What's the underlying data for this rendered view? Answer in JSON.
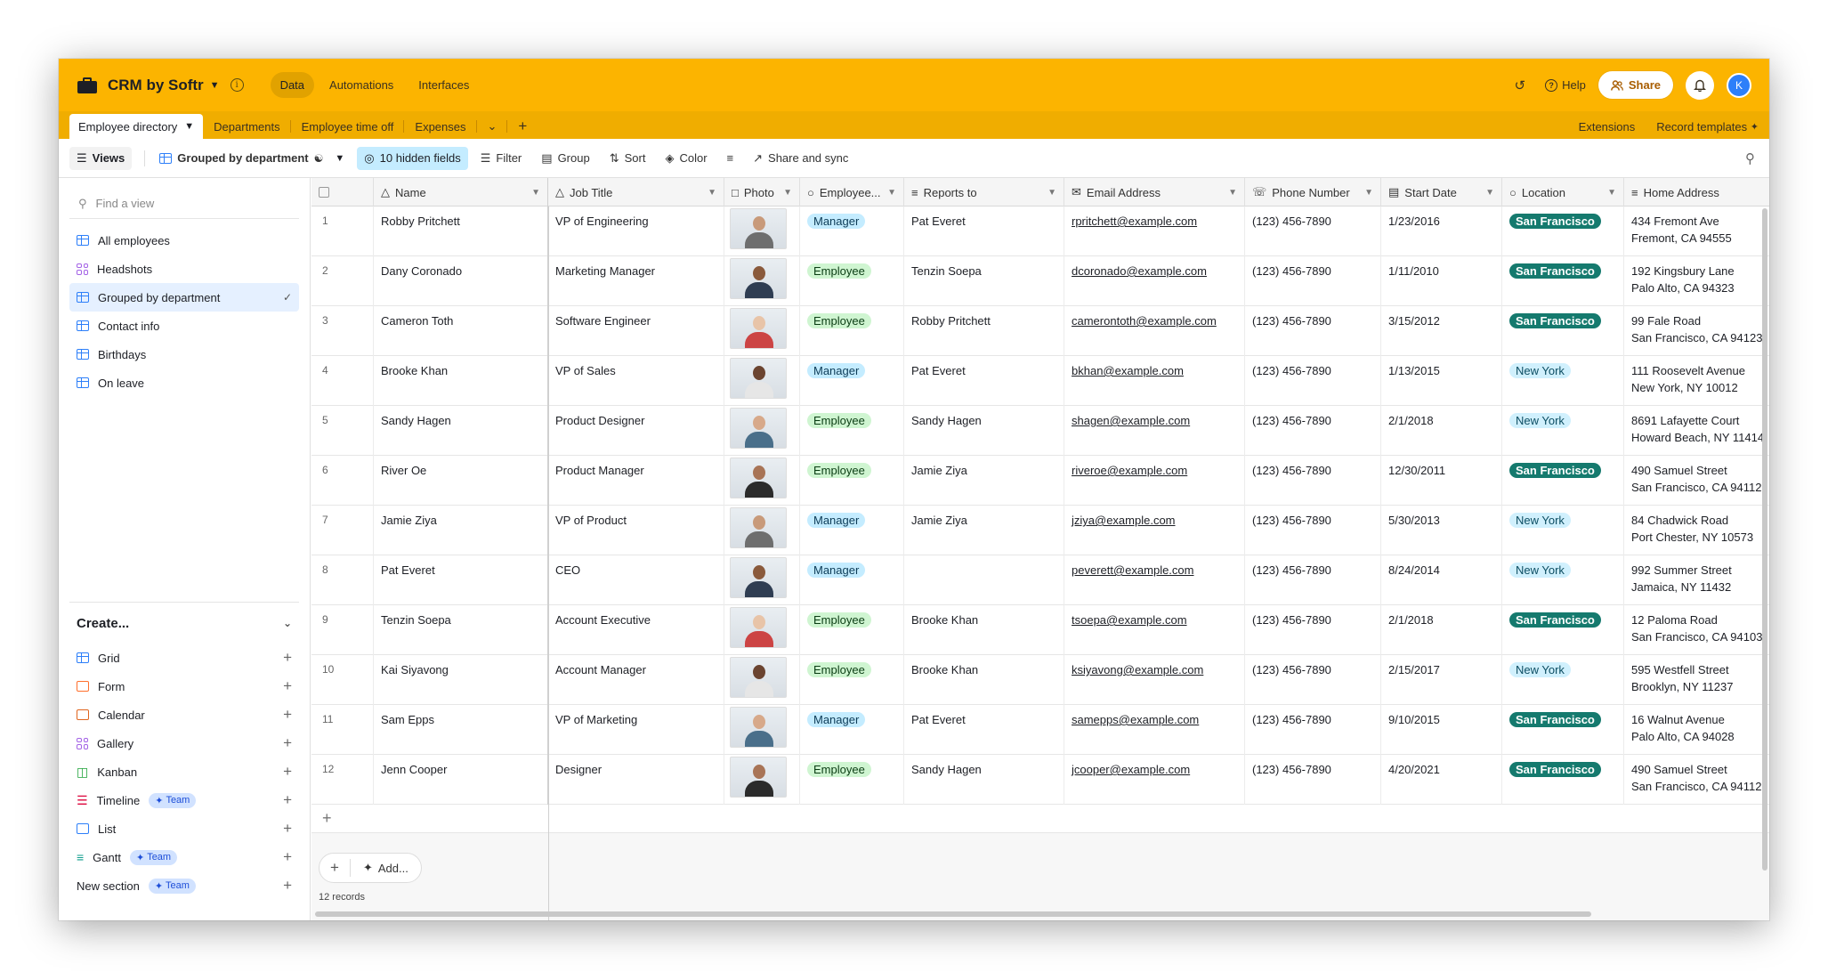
{
  "app": {
    "base_name": "CRM by Softr",
    "nav_tabs": [
      "Data",
      "Automations",
      "Interfaces"
    ],
    "help_label": "Help",
    "share_label": "Share",
    "avatar_initial": "K",
    "accent_color": "#fcb400"
  },
  "tables": {
    "items": [
      "Employee directory",
      "Departments",
      "Employee time off",
      "Expenses"
    ],
    "extensions_label": "Extensions",
    "record_templates_label": "Record templates"
  },
  "toolbar": {
    "views_label": "Views",
    "current_view": "Grouped by department",
    "hidden_fields": "10 hidden fields",
    "filter": "Filter",
    "group": "Group",
    "sort": "Sort",
    "color": "Color",
    "share_sync": "Share and sync"
  },
  "sidebar": {
    "find_placeholder": "Find a view",
    "views": [
      {
        "label": "All employees",
        "icon": "grid-icon"
      },
      {
        "label": "Headshots",
        "icon": "gallery-icon"
      },
      {
        "label": "Grouped by department",
        "icon": "grid-icon"
      },
      {
        "label": "Contact info",
        "icon": "grid-icon"
      },
      {
        "label": "Birthdays",
        "icon": "grid-icon"
      },
      {
        "label": "On leave",
        "icon": "grid-icon"
      }
    ],
    "create_label": "Create...",
    "create_items": [
      {
        "label": "Grid"
      },
      {
        "label": "Form"
      },
      {
        "label": "Calendar"
      },
      {
        "label": "Gallery"
      },
      {
        "label": "Kanban"
      },
      {
        "label": "Timeline",
        "badge": "Team"
      },
      {
        "label": "List"
      },
      {
        "label": "Gantt",
        "badge": "Team"
      },
      {
        "label": "New section",
        "badge": "Team"
      }
    ]
  },
  "grid": {
    "columns": [
      "Name",
      "Job Title",
      "Photo",
      "Employee...",
      "Reports to",
      "Email Address",
      "Phone Number",
      "Start Date",
      "Location",
      "Home Address"
    ],
    "rows": [
      {
        "n": "1",
        "name": "Robby Pritchett",
        "job": "VP of Engineering",
        "type": "Manager",
        "reports": "Pat Everet",
        "email": "rpritchett@example.com",
        "phone": "(123) 456-7890",
        "start": "1/23/2016",
        "loc": "San Francisco",
        "addr1": "434 Fremont Ave",
        "addr2": "Fremont, CA 94555",
        "edge": "6"
      },
      {
        "n": "2",
        "name": "Dany Coronado",
        "job": "Marketing Manager",
        "type": "Employee",
        "reports": "Tenzin Soepa",
        "email": "dcoronado@example.com",
        "phone": "(123) 456-7890",
        "start": "1/11/2010",
        "loc": "San Francisco",
        "addr1": "192 Kingsbury Lane",
        "addr2": "Palo Alto, CA 94323",
        "edge": "1"
      },
      {
        "n": "3",
        "name": "Cameron Toth",
        "job": "Software Engineer",
        "type": "Employee",
        "reports": "Robby Pritchett",
        "email": "camerontoth@example.com",
        "phone": "(123) 456-7890",
        "start": "3/15/2012",
        "loc": "San Francisco",
        "addr1": "99 Fale Road",
        "addr2": "San Francisco, CA 94123",
        "edge": "1"
      },
      {
        "n": "4",
        "name": "Brooke Khan",
        "job": "VP of Sales",
        "type": "Manager",
        "reports": "Pat Everet",
        "email": "bkhan@example.com",
        "phone": "(123) 456-7890",
        "start": "1/13/2015",
        "loc": "New York",
        "addr1": "111 Roosevelt Avenue",
        "addr2": "New York, NY 10012",
        "edge": "7"
      },
      {
        "n": "5",
        "name": "Sandy Hagen",
        "job": "Product Designer",
        "type": "Employee",
        "reports": "Sandy Hagen",
        "email": "shagen@example.com",
        "phone": "(123) 456-7890",
        "start": "2/1/2018",
        "loc": "New York",
        "addr1": "8691 Lafayette Court",
        "addr2": "Howard Beach, NY 11414",
        "edge": "4"
      },
      {
        "n": "6",
        "name": "River Oe",
        "job": "Product Manager",
        "type": "Employee",
        "reports": "Jamie Ziya",
        "email": "riveroe@example.com",
        "phone": "(123) 456-7890",
        "start": "12/30/2011",
        "loc": "San Francisco",
        "addr1": "490 Samuel Street",
        "addr2": "San Francisco, CA 94112",
        "edge": "3"
      },
      {
        "n": "7",
        "name": "Jamie Ziya",
        "job": "VP of Product",
        "type": "Manager",
        "reports": "Jamie Ziya",
        "email": "jziya@example.com",
        "phone": "(123) 456-7890",
        "start": "5/30/2013",
        "loc": "New York",
        "addr1": "84 Chadwick Road",
        "addr2": "Port Chester, NY 10573",
        "edge": "1,"
      },
      {
        "n": "8",
        "name": "Pat Everet",
        "job": "CEO",
        "type": "Manager",
        "reports": "",
        "email": "peverett@example.com",
        "phone": "(123) 456-7890",
        "start": "8/24/2014",
        "loc": "New York",
        "addr1": "992 Summer Street",
        "addr2": "Jamaica, NY 11432",
        "edge": "8"
      },
      {
        "n": "9",
        "name": "Tenzin Soepa",
        "job": "Account Executive",
        "type": "Employee",
        "reports": "Brooke Khan",
        "email": "tsoepa@example.com",
        "phone": "(123) 456-7890",
        "start": "2/1/2018",
        "loc": "San Francisco",
        "addr1": "12 Paloma Road",
        "addr2": "San Francisco, CA 94103",
        "edge": "5"
      },
      {
        "n": "10",
        "name": "Kai Siyavong",
        "job": "Account Manager",
        "type": "Employee",
        "reports": "Brooke Khan",
        "email": "ksiyavong@example.com",
        "phone": "(123) 456-7890",
        "start": "2/15/2017",
        "loc": "New York",
        "addr1": "595 Westfell Street",
        "addr2": "Brooklyn, NY 11237",
        "edge": "2"
      },
      {
        "n": "11",
        "name": "Sam Epps",
        "job": "VP of Marketing",
        "type": "Manager",
        "reports": "Pat Everet",
        "email": "samepps@example.com",
        "phone": "(123) 456-7890",
        "start": "9/10/2015",
        "loc": "San Francisco",
        "addr1": "16 Walnut Avenue",
        "addr2": "Palo Alto, CA 94028",
        "edge": "9"
      },
      {
        "n": "12",
        "name": "Jenn Cooper",
        "job": "Designer",
        "type": "Employee",
        "reports": "Sandy Hagen",
        "email": "jcooper@example.com",
        "phone": "(123) 456-7890",
        "start": "4/20/2021",
        "loc": "San Francisco",
        "addr1": "490 Samuel Street",
        "addr2": "San Francisco, CA 94112",
        "edge": "1"
      }
    ],
    "add_label": "Add...",
    "record_count": "12 records"
  }
}
